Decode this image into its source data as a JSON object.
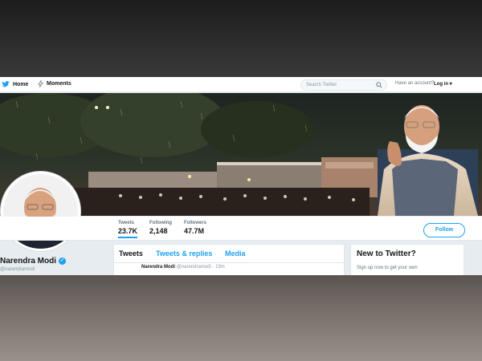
{
  "topnav": {
    "home_label": "Home",
    "moments_label": "Moments",
    "search_placeholder": "Search Twitter",
    "account_prompt": "Have an account?",
    "login_label": "Log in ▾"
  },
  "profile": {
    "name": "Narendra Modi",
    "handle": "@narendramodi"
  },
  "stats": [
    {
      "label": "Tweets",
      "value": "23.7K"
    },
    {
      "label": "Following",
      "value": "2,148"
    },
    {
      "label": "Followers",
      "value": "47.7M"
    }
  ],
  "follow_label": "Follow",
  "timeline": {
    "tabs": [
      "Tweets",
      "Tweets & replies",
      "Media"
    ],
    "preview_name": "Narendra Modi",
    "preview_meta": "@narendramodi · 19m"
  },
  "new_card": {
    "title": "New to Twitter?",
    "subtitle": "Sign up now to get your own"
  },
  "colors": {
    "accent": "#1da1f2",
    "text": "#14171a",
    "muted": "#66757f",
    "background": "#e6ecf0"
  }
}
